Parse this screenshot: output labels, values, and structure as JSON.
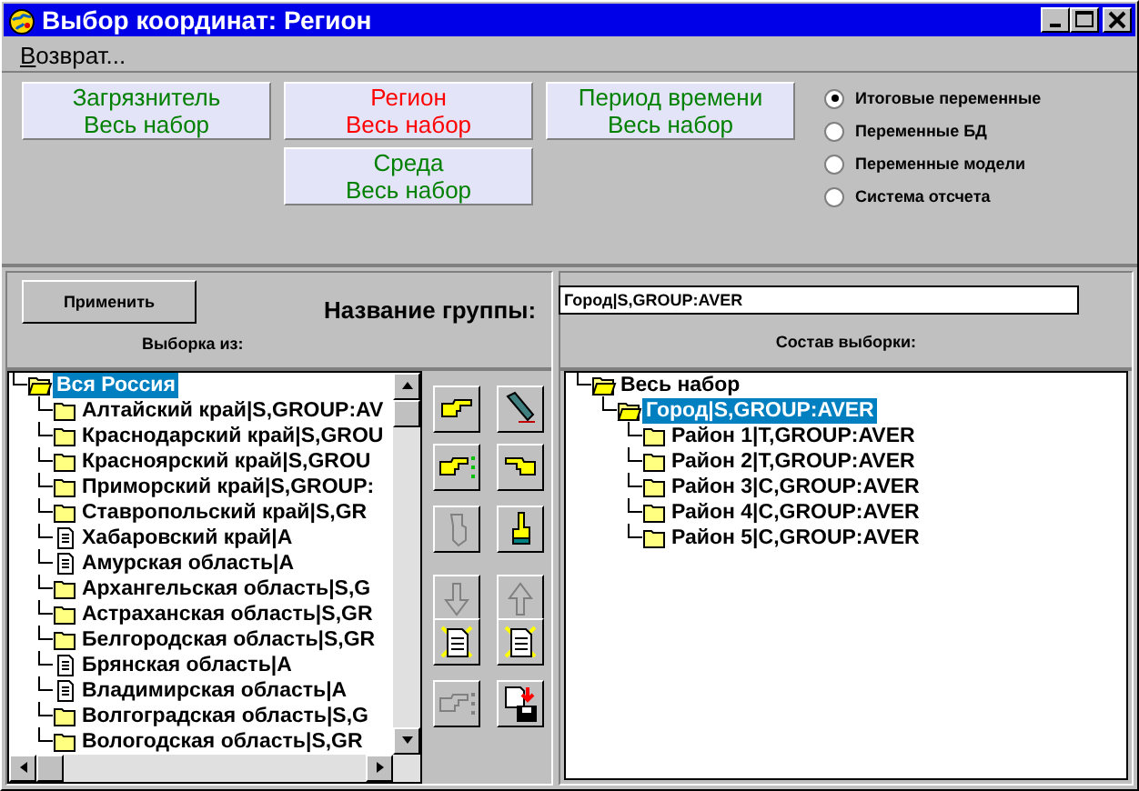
{
  "window": {
    "title": "Выбор координат: Регион"
  },
  "menu": [
    {
      "label": "Возврат..."
    }
  ],
  "coordinates": [
    {
      "label": "Загрязнитель",
      "value": "Весь набор",
      "selected": false
    },
    {
      "label": "Регион",
      "value": "Весь набор",
      "selected": true
    },
    {
      "label": "Период времени",
      "value": "Весь набор",
      "selected": false
    },
    {
      "label": "Среда",
      "value": "Весь набор",
      "selected": false
    }
  ],
  "variable_types": [
    {
      "label": "Итоговые переменные",
      "selected": true
    },
    {
      "label": "Переменные БД",
      "selected": false
    },
    {
      "label": "Переменные модели",
      "selected": false
    },
    {
      "label": "Система отсчета",
      "selected": false
    }
  ],
  "apply_button": "Применить",
  "group_name_label": "Название группы:",
  "group_name": "Город|S,GROUP:AVER",
  "source_label": "Выборка из:",
  "source_tree": [
    {
      "label": "Вся Россия",
      "kind": "folder",
      "expanded": true,
      "selected": true,
      "children": [
        {
          "label": "Алтайский край|S,GROUP:AV",
          "kind": "folder",
          "selected": false
        },
        {
          "label": "Краснодарский край|S,GROU",
          "kind": "folder",
          "selected": false
        },
        {
          "label": "Красноярский край|S,GROU",
          "kind": "folder",
          "selected": false
        },
        {
          "label": "Приморский край|S,GROUP:",
          "kind": "folder",
          "selected": false
        },
        {
          "label": "Ставропольский край|S,GR",
          "kind": "folder",
          "selected": false
        },
        {
          "label": "Хабаровский край|A",
          "kind": "document",
          "selected": false
        },
        {
          "label": "Амурская область|A",
          "kind": "document",
          "selected": false
        },
        {
          "label": "Архангельская область|S,G",
          "kind": "folder",
          "selected": false
        },
        {
          "label": "Астраханская область|S,GR",
          "kind": "folder",
          "selected": false
        },
        {
          "label": "Белгородская область|S,GR",
          "kind": "folder",
          "selected": false
        },
        {
          "label": "Брянская область|A",
          "kind": "document",
          "selected": false
        },
        {
          "label": "Владимирская область|A",
          "kind": "document",
          "selected": false
        },
        {
          "label": "Волгоградская область|S,G",
          "kind": "folder",
          "selected": false
        },
        {
          "label": "Вологодская область|S,GR",
          "kind": "folder",
          "selected": false
        }
      ]
    }
  ],
  "tools": [
    {
      "kind": "hand-right",
      "disabled": false
    },
    {
      "kind": "pen",
      "disabled": false
    },
    {
      "kind": "hand-right-dots",
      "disabled": false
    },
    {
      "kind": "hand-left",
      "disabled": false
    },
    {
      "kind": "hand-down",
      "disabled": true
    },
    {
      "kind": "hand-up",
      "disabled": false
    },
    {
      "kind": "arrow-down",
      "disabled": true
    },
    {
      "kind": "arrow-up",
      "disabled": true
    },
    {
      "kind": "doc-star",
      "disabled": false
    },
    {
      "kind": "doc-star",
      "disabled": false
    },
    {
      "kind": "hand-right-dots",
      "disabled": true
    },
    {
      "kind": "save",
      "disabled": false
    }
  ],
  "result_label": "Состав выборки:",
  "result_tree": [
    {
      "label": "Весь набор",
      "kind": "folder",
      "expanded": true,
      "selected": false,
      "children": [
        {
          "label": "Город|S,GROUP:AVER",
          "kind": "folder",
          "expanded": true,
          "selected": true,
          "children": [
            {
              "label": "Район 1|T,GROUP:AVER",
              "kind": "folder",
              "selected": false
            },
            {
              "label": "Район 2|T,GROUP:AVER",
              "kind": "folder",
              "selected": false
            },
            {
              "label": "Район 3|C,GROUP:AVER",
              "kind": "folder",
              "selected": false
            },
            {
              "label": "Район 4|C,GROUP:AVER",
              "kind": "folder",
              "selected": false
            },
            {
              "label": "Район 5|C,GROUP:AVER",
              "kind": "folder",
              "selected": false
            }
          ]
        }
      ]
    }
  ]
}
